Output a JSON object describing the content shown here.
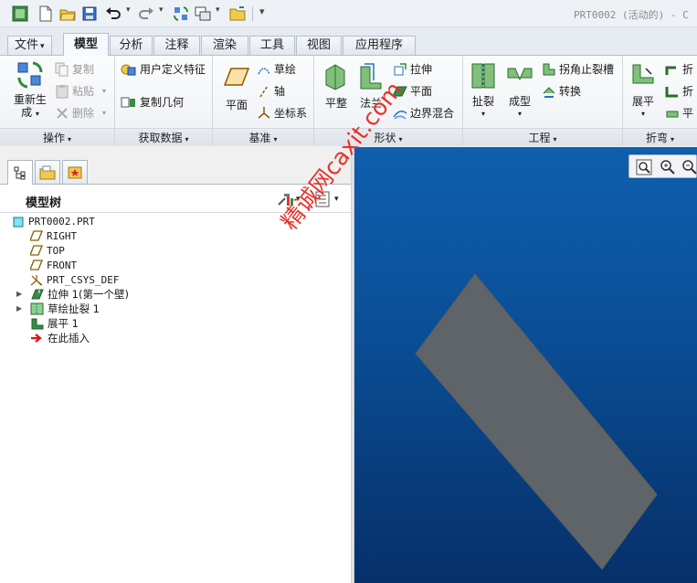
{
  "window": {
    "title": "PRT0002 (活动的) - C"
  },
  "quick_access": {
    "icons": [
      "app-icon",
      "new-icon",
      "open-icon",
      "save-icon",
      "undo-icon",
      "redo-icon",
      "regenerate-icon",
      "windows-icon",
      "folder-icon",
      "customize-icon"
    ]
  },
  "tabs": [
    {
      "label": "文件",
      "dropdown": "▾"
    },
    {
      "label": "模型"
    },
    {
      "label": "分析"
    },
    {
      "label": "注释"
    },
    {
      "label": "渲染"
    },
    {
      "label": "工具"
    },
    {
      "label": "视图"
    },
    {
      "label": "应用程序"
    }
  ],
  "ribbon": {
    "groups": [
      {
        "label": "操作",
        "dropdown": "▾"
      },
      {
        "label": "获取数据",
        "dropdown": "▾"
      },
      {
        "label": "基准",
        "dropdown": "▾"
      },
      {
        "label": "形状",
        "dropdown": "▾"
      },
      {
        "label": "工程",
        "dropdown": "▾"
      },
      {
        "label": "折弯",
        "dropdown": "▾"
      }
    ],
    "operations": {
      "regenerate_line1": "重新生",
      "regenerate_line2": "成",
      "copy": "复制",
      "paste": "粘贴",
      "delete": "删除"
    },
    "get_data": {
      "user_defined_feature": "用户定义特征",
      "copy_geometry": "复制几何"
    },
    "datum": {
      "plane": "平面",
      "sketch": "草绘",
      "axis": "轴",
      "csys": "坐标系"
    },
    "shape": {
      "flat": "平整",
      "flange": "法兰",
      "extrude": "拉伸",
      "plane": "平面",
      "boundary_blend": "边界混合"
    },
    "engineering": {
      "rip": "扯裂",
      "form": "成型",
      "corner_relief": "拐角止裂槽",
      "convert": "转换"
    },
    "bend": {
      "unbend": "展平",
      "bend1": "折",
      "bend2": "折",
      "flatten": "平"
    }
  },
  "model_tree": {
    "title": "模型树",
    "items": [
      {
        "label": "PRT0002.PRT",
        "icon": "part-icon"
      },
      {
        "label": "RIGHT",
        "icon": "datum-plane-icon"
      },
      {
        "label": "TOP",
        "icon": "datum-plane-icon"
      },
      {
        "label": "FRONT",
        "icon": "datum-plane-icon"
      },
      {
        "label": "PRT_CSYS_DEF",
        "icon": "csys-icon"
      },
      {
        "label": "拉伸 1(第一个壁)",
        "icon": "extrude-wall-icon",
        "expandable": true
      },
      {
        "label": "草绘扯裂 1",
        "icon": "sketch-rip-icon",
        "expandable": true
      },
      {
        "label": "展平 1",
        "icon": "unbend-icon"
      },
      {
        "label": "在此插入",
        "icon": "insert-here-arrow-icon"
      }
    ]
  },
  "viewport": {
    "watermark": "精诚网caxit.com",
    "background_top": "#0f5fae",
    "background_bottom": "#06306a",
    "part_color": "#5f6468"
  },
  "colors": {
    "accent_green": "#2e8b3a",
    "accent_blue": "#2a6fc2",
    "watermark_red": "#e8322a"
  }
}
